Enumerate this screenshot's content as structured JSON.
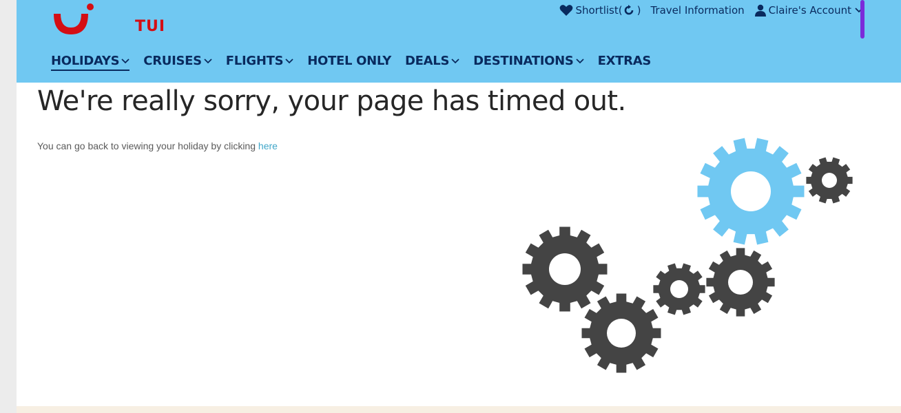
{
  "brand": {
    "name": "TUI",
    "logo_color": "#d40e14"
  },
  "header": {
    "background": "#70c8f2",
    "utility": {
      "shortlist_label": "Shortlist(",
      "shortlist_close": ")",
      "travel_info_label": "Travel Information",
      "account_label": "Claire's Account"
    },
    "nav": [
      {
        "label": "HOLIDAYS",
        "has_dropdown": true,
        "active": true
      },
      {
        "label": "CRUISES",
        "has_dropdown": true
      },
      {
        "label": "FLIGHTS",
        "has_dropdown": true
      },
      {
        "label": "HOTEL ONLY",
        "has_dropdown": false
      },
      {
        "label": "DEALS",
        "has_dropdown": true
      },
      {
        "label": "DESTINATIONS",
        "has_dropdown": true
      },
      {
        "label": "EXTRAS",
        "has_dropdown": false
      }
    ]
  },
  "main": {
    "headline": "We're really sorry, your page has timed out.",
    "message": "You can go back to viewing your holiday by clicking ",
    "link_text": "here"
  },
  "icons": {
    "heart": "heart-icon",
    "refresh": "refresh-icon",
    "user": "user-icon",
    "chevron": "chevron-down-icon",
    "gears": "gears-illustration"
  },
  "colors": {
    "navy": "#092a5e",
    "gear_dark": "#444444",
    "gear_light": "#70c8f2",
    "link": "#3fa6c8"
  }
}
